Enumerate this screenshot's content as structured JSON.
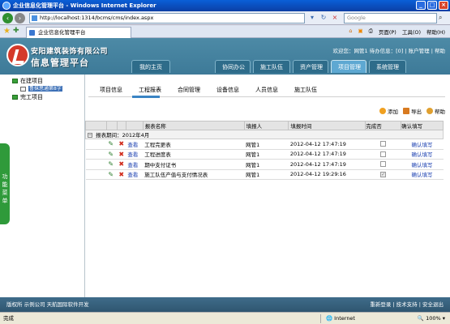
{
  "window": {
    "title": "企业信息化管理平台 - Windows Internet Explorer"
  },
  "browser": {
    "address": "http://localhost:1314/bcms/cms/index.aspx",
    "search_placeholder": "Google",
    "tab_label": "企业信息化管理平台",
    "commands": [
      "页面(P)",
      "工具(O)",
      "帮助(H)"
    ]
  },
  "header": {
    "logo_line1": "安阳建筑装饰有限公司",
    "logo_line2": "信息管理平台",
    "welcome": "欢迎您：网管1 待办信息：[0] | 账户管理 | 帮助",
    "nav": [
      {
        "label": "我的主页"
      },
      {
        "label": "协同办公"
      },
      {
        "label": "施工队伍"
      },
      {
        "label": "资产管理"
      },
      {
        "label": "项目管理"
      },
      {
        "label": "系统管理"
      }
    ]
  },
  "sidebar": {
    "tree": [
      {
        "label": "在建项目"
      },
      {
        "label": "完工项目"
      }
    ],
    "selected_sub": "鲁抹思通第8字",
    "side_tab": "功能菜单"
  },
  "subtabs": [
    "项目信息",
    "工程报表",
    "合同管理",
    "设备信息",
    "人员信息",
    "施工队伍"
  ],
  "actions": {
    "add": "添加",
    "export": "导出",
    "help": "帮助"
  },
  "table": {
    "headers": [
      "报表名称",
      "填报人",
      "填报时间",
      "完成否",
      "确认填写"
    ],
    "group_label": "报表期间：2012年4月",
    "view_label": "查看",
    "rows": [
      {
        "name": "工程完更表",
        "user": "网管1",
        "time": "2012-04-12 17:47:19",
        "done": false,
        "confirm": "确认填写"
      },
      {
        "name": "工程进度表",
        "user": "网管1",
        "time": "2012-04-12 17:47:19",
        "done": false,
        "confirm": "确认填写"
      },
      {
        "name": "期中支付证书",
        "user": "网管1",
        "time": "2012-04-12 17:47:19",
        "done": false,
        "confirm": "确认填写"
      },
      {
        "name": "施工队伍产值与支付情况表",
        "user": "网管1",
        "time": "2012-04-12 19:29:16",
        "done": true,
        "confirm": "确认填写"
      }
    ]
  },
  "footer": {
    "left": "版权所 示例公司 天航国际软件开发",
    "right": "重新登录 | 技术支持 | 安全退出"
  },
  "statusbar": {
    "left": "完成",
    "zone": "Internet",
    "zoom": "100%"
  }
}
